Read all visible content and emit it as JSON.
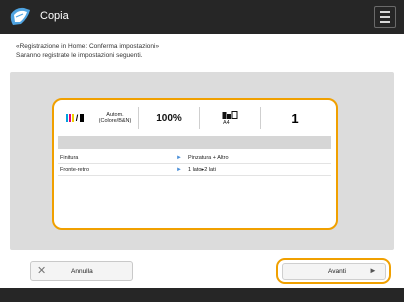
{
  "header": {
    "title": "Copia",
    "app_icon": "copy-icon",
    "menu_icon": "menu-icon"
  },
  "message": {
    "line1": "«Registrazione in Home: Conferma impostazioni»",
    "line2": "Saranno registrate le impostazioni seguenti."
  },
  "summary": {
    "color_mode": "Autom. (Colore/B&N)",
    "color_icon": "color-bw-icon",
    "zoom": "100%",
    "paper_icon": "paper-source-icon",
    "paper_size": "A4",
    "copies": "1"
  },
  "settings": [
    {
      "name": "Finitura",
      "value": "Pinzatura + Altro"
    },
    {
      "name": "Fronte-retro",
      "value": "1 lato▸2 lati"
    }
  ],
  "buttons": {
    "cancel_label": "Annulla",
    "cancel_icon": "close-icon",
    "next_label": "Avanti",
    "next_icon": "arrow-right-icon"
  },
  "colors": {
    "accent": "#f0a000",
    "titlebar": "#262626",
    "panel_bg": "#dcdcdc"
  }
}
